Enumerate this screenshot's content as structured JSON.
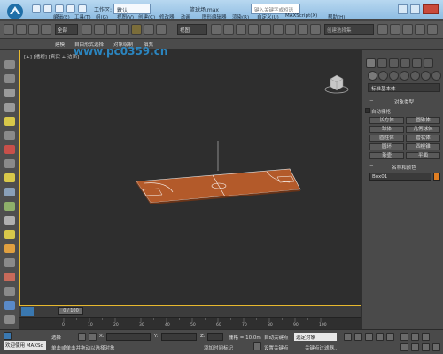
{
  "title_bar": {
    "workspace_label": "工作区:",
    "workspace_value": "默认",
    "file_title": "篮球场.max",
    "search_placeholder": "键入关键字或短语"
  },
  "menu": [
    "编辑(E)",
    "工具(T)",
    "组(G)",
    "视图(V)",
    "创建(C)",
    "修改器",
    "动画",
    "图形编辑器",
    "渲染(R)",
    "自定义(U)",
    "MAXScript(X)",
    "帮助(H)"
  ],
  "toolbar": {
    "selection_filter": "全部",
    "reference_coord": "视图",
    "named_selection_placeholder": "创建选择集"
  },
  "ribbon_tabs": [
    "建模",
    "自由形式",
    "选择",
    "对象绘制",
    "填充"
  ],
  "viewport": {
    "label": "[+] [透视] [真实 + 边面]",
    "watermark": "www.pc0359.cn"
  },
  "command_panel": {
    "category": "标准基本体",
    "object_type_title": "对象类型",
    "autogrid": "自动栅格",
    "buttons": [
      "长方体",
      "圆锥体",
      "球体",
      "几何球体",
      "圆柱体",
      "管状体",
      "圆环",
      "四棱锥",
      "茶壶",
      "平面"
    ],
    "name_color_title": "名称和颜色",
    "name_value": "Box01",
    "swatch_color": "#e07e22"
  },
  "timeline": {
    "slider_label": "0 / 100",
    "ticks": [
      "0",
      "10",
      "20",
      "30",
      "40",
      "50",
      "60",
      "70",
      "80",
      "90",
      "100"
    ]
  },
  "status": {
    "welcome": "欢迎使用 MAXSc",
    "selected": "选择",
    "x_label": "X:",
    "y_label": "Y:",
    "z_label": "Z:",
    "grid": "栅格 = 10.0m",
    "auto_key": "自动关键点",
    "key_mode": "选定对象",
    "set_key": "设置关键点",
    "key_filters": "关键点过滤器...",
    "prompt": "单击或单击并拖动以选择对象",
    "add_time_tag": "添加时间标记"
  }
}
